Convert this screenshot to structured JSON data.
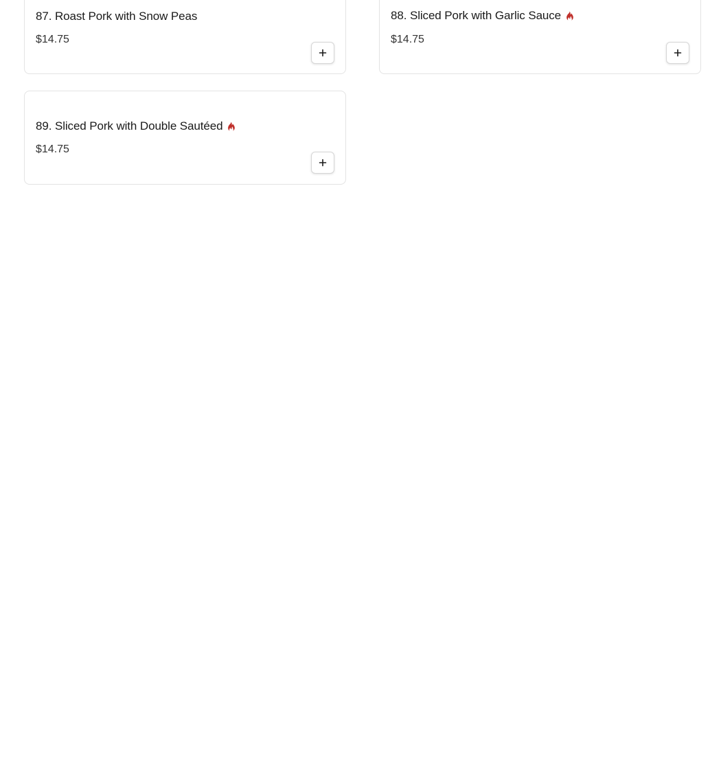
{
  "menu": {
    "items": [
      {
        "name": "87. Roast Pork with Snow Peas",
        "price": "$14.75",
        "spicy": false,
        "add_icon": "plus-icon"
      },
      {
        "name": "88. Sliced Pork with Garlic Sauce",
        "price": "$14.75",
        "spicy": true,
        "spicy_icon": "flame-icon",
        "add_icon": "plus-icon"
      },
      {
        "name": "89. Sliced Pork with Double Sautéed",
        "price": "$14.75",
        "spicy": true,
        "spicy_icon": "flame-icon",
        "add_icon": "plus-icon"
      }
    ]
  },
  "colors": {
    "spicy": "#c0302b",
    "card_border": "#e3e3e3",
    "text": "#1a1a1a"
  }
}
